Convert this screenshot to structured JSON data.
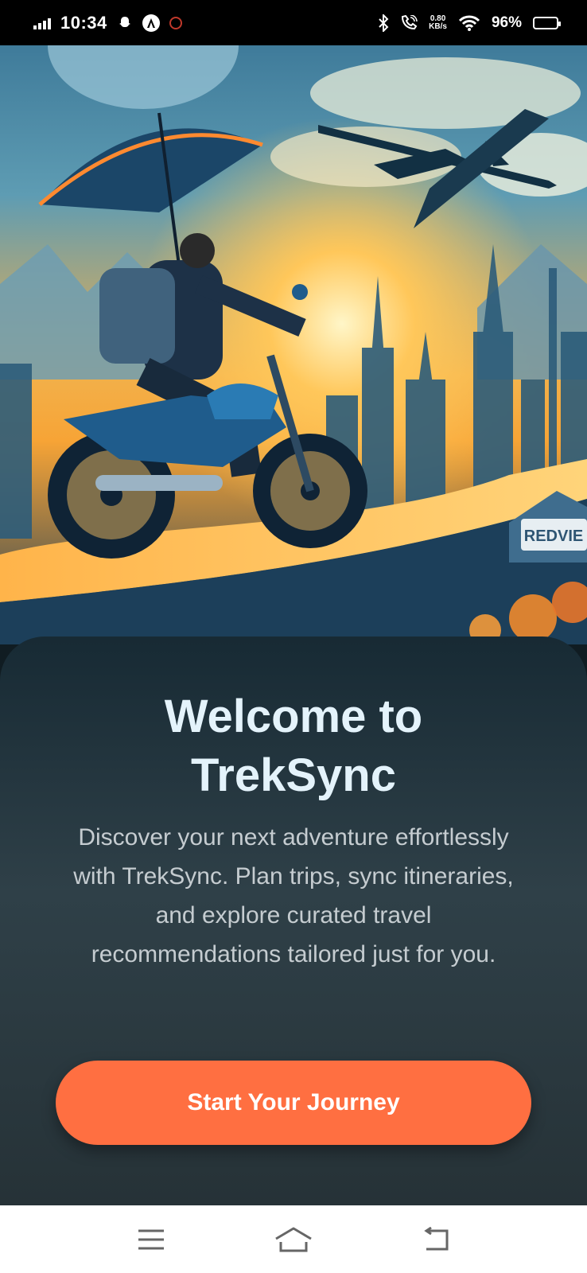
{
  "status_bar": {
    "time": "10:34",
    "net_speed_value": "0.80",
    "net_speed_unit": "KB/s",
    "battery": "96%",
    "icons": [
      "signal-icon",
      "snapchat-icon",
      "app-a-icon",
      "notification-icon",
      "bluetooth-icon",
      "call-icon",
      "wifi-icon",
      "battery-icon"
    ]
  },
  "hero": {
    "sign_text": "REDVIE"
  },
  "welcome": {
    "title_line1": "Welcome to",
    "title_line2": "TrekSync",
    "description": "Discover your next adventure effortlessly with TrekSync. Plan trips, sync itineraries, and explore curated travel recommendations tailored just for you.",
    "cta_label": "Start Your Journey"
  },
  "colors": {
    "accent": "#ff6f41",
    "card_bg": "#1f3038",
    "title": "#e4f3fb",
    "text": "#c5ccd0"
  },
  "nav_bar": {
    "icons": [
      "menu-icon",
      "home-icon",
      "back-icon"
    ]
  }
}
